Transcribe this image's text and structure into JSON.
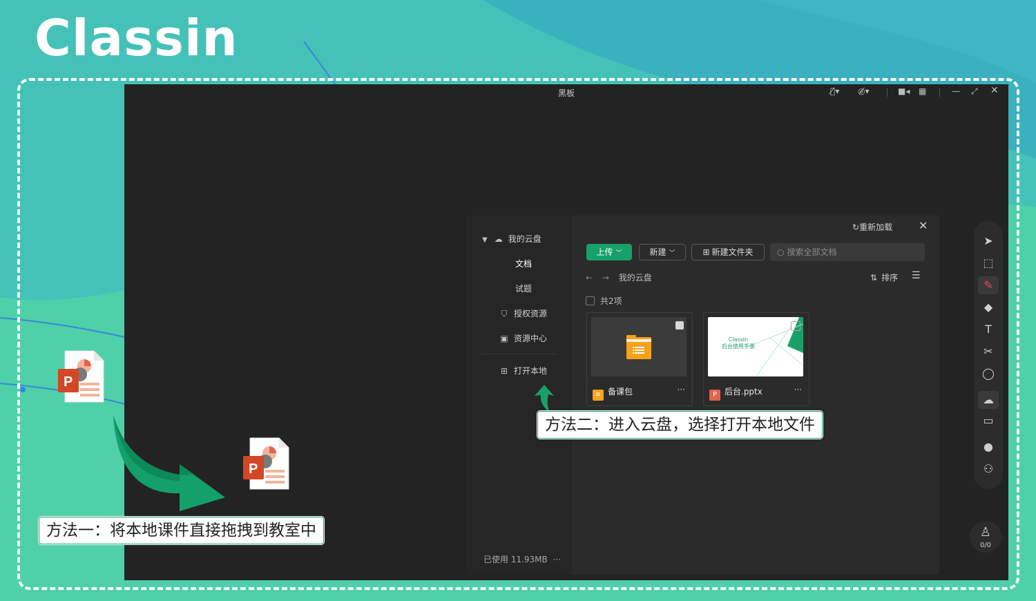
{
  "brand": {
    "logo_text": "Classin"
  },
  "board": {
    "title": "黑板",
    "titlebar_icons": [
      "mic-muted-icon",
      "camera-muted-icon",
      "video-icon",
      "grid-icon",
      "minimize-icon",
      "fullscreen-icon",
      "close-icon"
    ]
  },
  "toolbar": {
    "tools": [
      "cursor-icon",
      "select-area-icon",
      "pen-icon",
      "eraser-icon",
      "text-icon",
      "scissors-icon",
      "shape-icon",
      "cloud-icon",
      "toolbox-icon",
      "chat-icon",
      "users-icon"
    ],
    "seat_count": "0/0"
  },
  "cloud": {
    "sidebar": {
      "my_cloud": "我的云盘",
      "documents": "文档",
      "quizzes": "试题",
      "licensed": "授权资源",
      "resource_center": "资源中心",
      "open_local": "打开本地",
      "usage": "已使用 11.93MB"
    },
    "reload": "重新加载",
    "upload_label": "上传",
    "new_label": "新建",
    "new_folder_label": "新建文件夹",
    "search_placeholder": "搜索全部文档",
    "breadcrumb": "我的云盘",
    "sort_label": "排序",
    "item_count": "共2项",
    "files": [
      {
        "name": "备课包",
        "type": "folder"
      },
      {
        "name": "后台.pptx",
        "type": "pptx",
        "thumb_line1": "ClassIn",
        "thumb_line2": "后台使用手册"
      }
    ]
  },
  "callouts": {
    "method_two": "方法二：进入云盘，选择打开本地文件",
    "method_one": "方法一：将本地课件直接拖拽到教室中"
  },
  "colors": {
    "accent": "#18a06a",
    "board": "#232323",
    "background": "#4fd0a8"
  }
}
